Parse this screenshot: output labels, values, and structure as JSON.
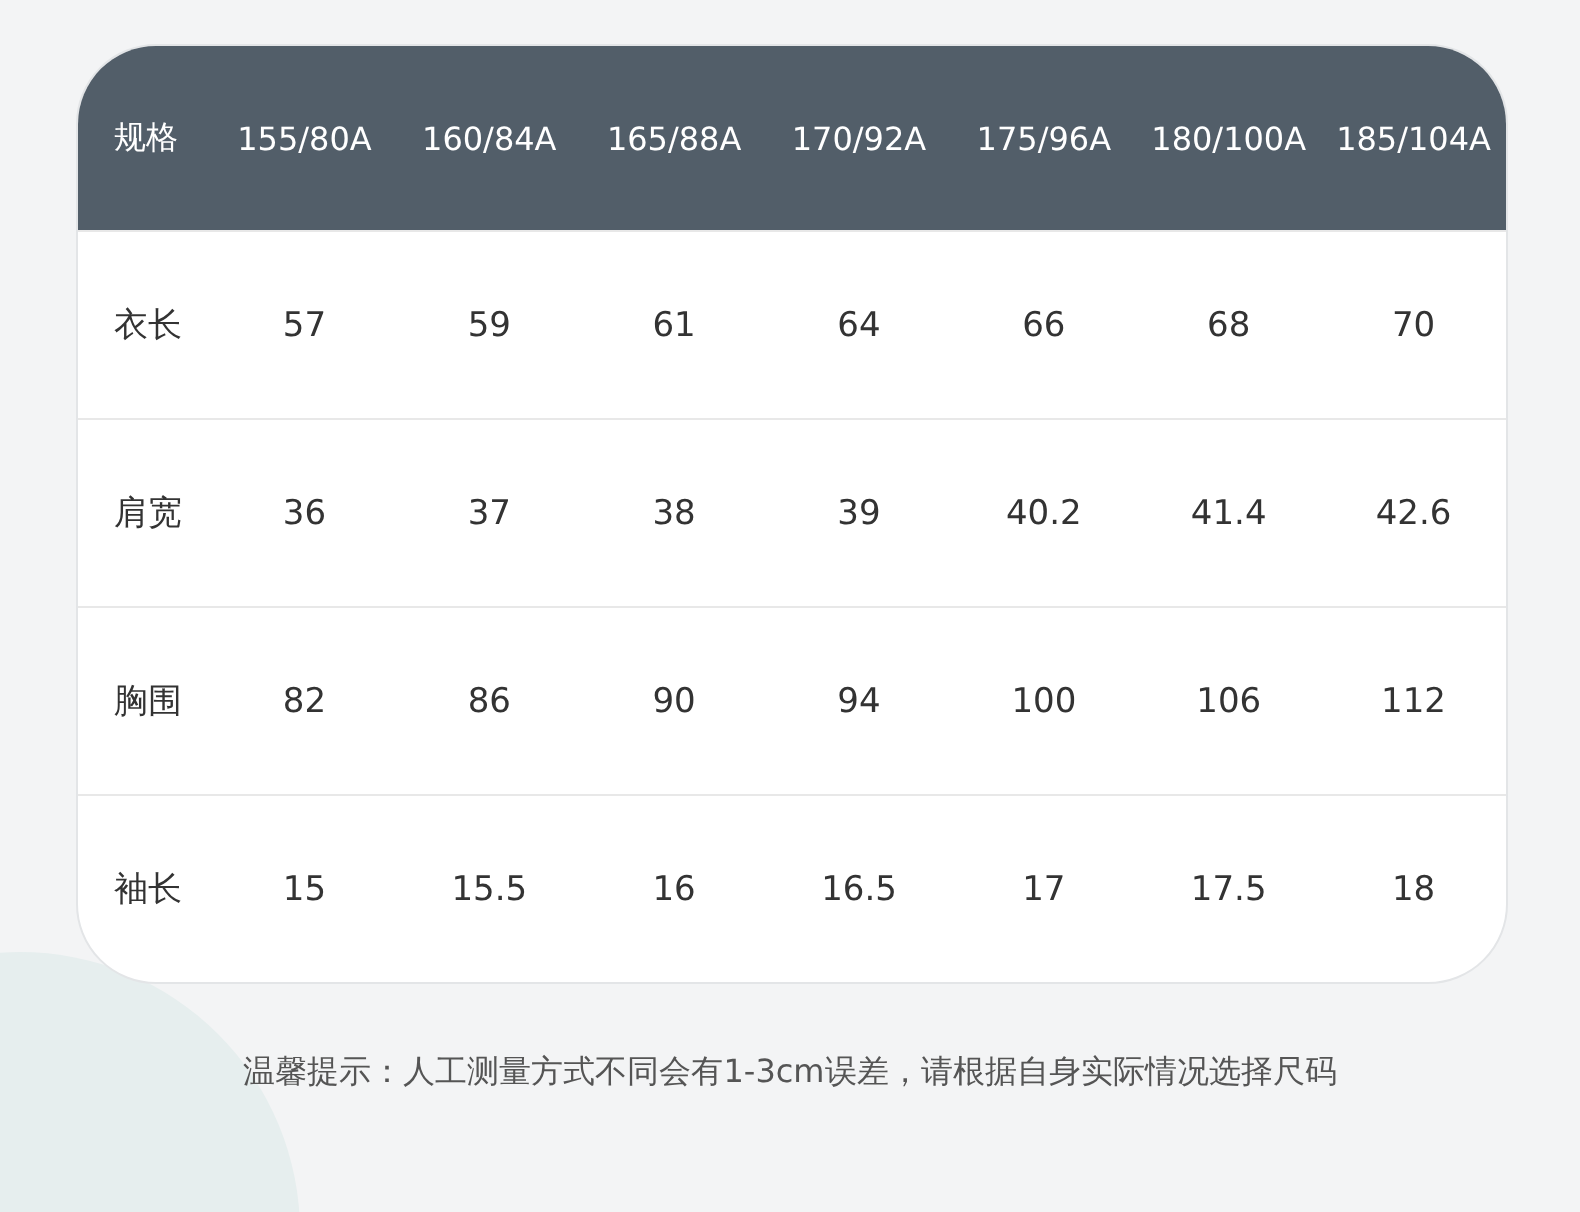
{
  "table": {
    "columns": [
      "规格",
      "155/80A",
      "160/84A",
      "165/88A",
      "170/92A",
      "175/96A",
      "180/100A",
      "185/104A"
    ],
    "rows": [
      {
        "cells": [
          "衣长",
          "57",
          "59",
          "61",
          "64",
          "66",
          "68",
          "70"
        ]
      },
      {
        "cells": [
          "肩宽",
          "36",
          "37",
          "38",
          "39",
          "40.2",
          "41.4",
          "42.6"
        ]
      },
      {
        "cells": [
          "胸围",
          "82",
          "86",
          "90",
          "94",
          "100",
          "106",
          "112"
        ]
      },
      {
        "cells": [
          "袖长",
          "15",
          "15.5",
          "16",
          "16.5",
          "17",
          "17.5",
          "18"
        ]
      }
    ]
  },
  "note": "温馨提示：人工测量方式不同会有1-3cm误差，请根据自身实际情况选择尺码"
}
